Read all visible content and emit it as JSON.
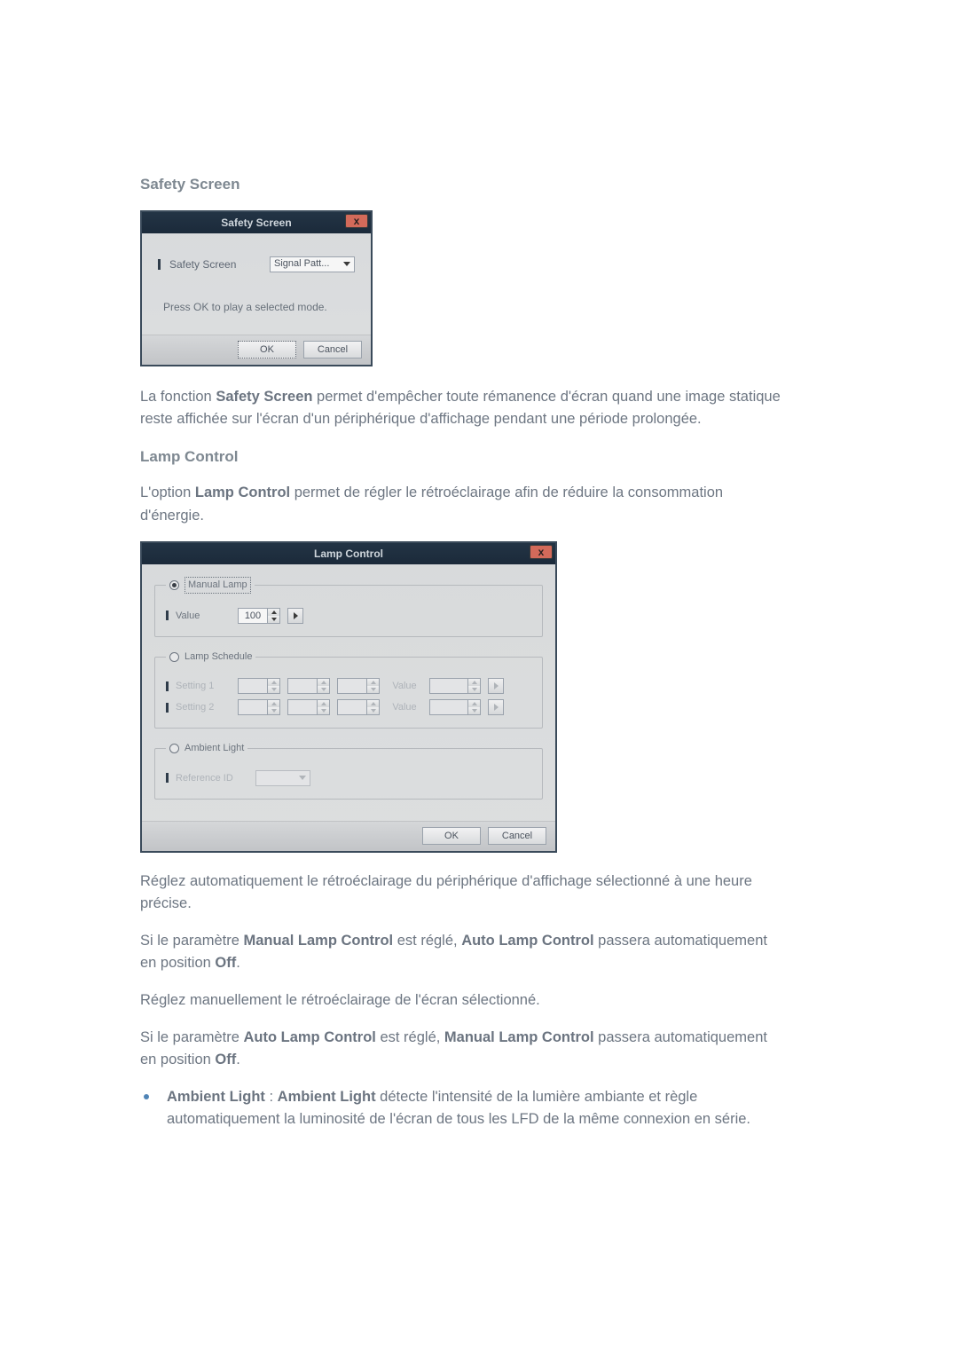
{
  "safety": {
    "heading": "Safety Screen",
    "dialog": {
      "title": "Safety Screen",
      "field_label": "Safety Screen",
      "select_value": "Signal Patt...",
      "hint": "Press OK to play a selected mode.",
      "ok": "OK",
      "cancel": "Cancel",
      "close": "x"
    },
    "desc_pre": "La fonction ",
    "desc_bold": "Safety Screen",
    "desc_post": " permet d'empêcher toute rémanence d'écran quand une image statique reste affichée sur l'écran d'un périphérique d'affichage pendant une période prolongée."
  },
  "lamp": {
    "heading": "Lamp Control",
    "intro_pre": "L'option ",
    "intro_bold": "Lamp Control",
    "intro_post": " permet de régler le rétroéclairage afin de réduire la consommation d'énergie.",
    "dialog": {
      "title": "Lamp Control",
      "close": "x",
      "manual": {
        "legend": "Manual Lamp",
        "value_label": "Value",
        "value": "100"
      },
      "schedule": {
        "legend": "Lamp Schedule",
        "setting1_label": "Setting 1",
        "setting2_label": "Setting 2",
        "value_word": "Value"
      },
      "ambient": {
        "legend": "Ambient Light",
        "ref_label": "Reference ID"
      },
      "ok": "OK",
      "cancel": "Cancel"
    },
    "p1": "Réglez automatiquement le rétroéclairage du périphérique d'affichage sélectionné à une heure précise.",
    "p2_pre": "Si le paramètre ",
    "p2_b1": "Manual Lamp Control",
    "p2_mid": " est réglé, ",
    "p2_b2": "Auto Lamp Control",
    "p2_post1": " passera automatiquement en position ",
    "p2_b3": "Off",
    "p2_end": ".",
    "p3": "Réglez manuellement le rétroéclairage de l'écran sélectionné.",
    "p4_pre": "Si le paramètre ",
    "p4_b1": "Auto Lamp Control",
    "p4_mid": " est réglé, ",
    "p4_b2": "Manual Lamp Control",
    "p4_post1": " passera automatiquement en position ",
    "p4_b3": "Off",
    "p4_end": ".",
    "bullet_b1": "Ambient Light",
    "bullet_sep": " : ",
    "bullet_b2": "Ambient Light",
    "bullet_rest": " détecte l'intensité de la lumière ambiante et règle automatiquement la luminosité de l'écran de tous les LFD de la même connexion en série."
  }
}
